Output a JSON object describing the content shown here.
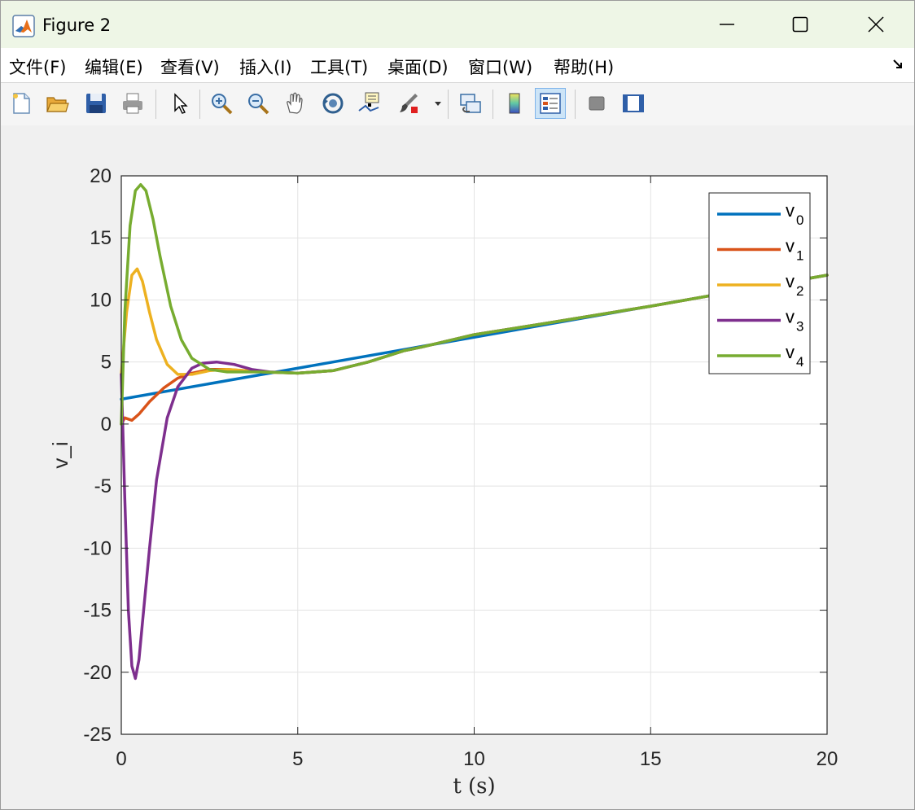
{
  "window": {
    "title": "Figure 2"
  },
  "menubar": {
    "items": [
      "文件(F)",
      "编辑(E)",
      "查看(V)",
      "插入(I)",
      "工具(T)",
      "桌面(D)",
      "窗口(W)",
      "帮助(H)"
    ]
  },
  "toolbar": {
    "icons": [
      "new-figure-icon",
      "open-file-icon",
      "save-icon",
      "print-icon",
      "pointer-icon",
      "zoom-in-icon",
      "zoom-out-icon",
      "pan-icon",
      "rotate-3d-icon",
      "data-cursor-icon",
      "brush-icon",
      "link-plot-icon",
      "colorbar-icon",
      "legend-icon",
      "hide-plot-tools-icon",
      "show-plot-tools-icon"
    ]
  },
  "chart_data": {
    "type": "line",
    "title": "",
    "xlabel": "t (s)",
    "ylabel": "v_i",
    "xlim": [
      0,
      20
    ],
    "ylim": [
      -25,
      20
    ],
    "xticks": [
      0,
      5,
      10,
      15,
      20
    ],
    "yticks": [
      -25,
      -20,
      -15,
      -10,
      -5,
      0,
      5,
      10,
      15,
      20
    ],
    "grid": true,
    "legend_position": "top-right",
    "series": [
      {
        "name": "v",
        "sub": "0",
        "color": "#0072bd",
        "x": [
          0,
          20
        ],
        "y": [
          2,
          12
        ]
      },
      {
        "name": "v",
        "sub": "1",
        "color": "#d95319",
        "x": [
          0,
          0.1,
          0.3,
          0.5,
          0.8,
          1.2,
          1.6,
          2.0,
          2.5,
          3.0,
          4.0,
          5.0,
          6.0,
          7.0,
          8.0,
          8.5,
          10,
          12,
          15,
          20
        ],
        "y": [
          0,
          0.5,
          0.3,
          0.8,
          1.8,
          2.9,
          3.7,
          4.1,
          4.4,
          4.4,
          4.2,
          4.1,
          4.3,
          5.0,
          5.9,
          6.2,
          7.2,
          8.1,
          9.5,
          12
        ]
      },
      {
        "name": "v",
        "sub": "2",
        "color": "#edb120",
        "x": [
          0,
          0.15,
          0.3,
          0.45,
          0.6,
          0.8,
          1.0,
          1.3,
          1.6,
          2.0,
          2.5,
          3.0,
          4.0,
          5.0,
          6.0,
          7.0,
          8.0,
          8.5,
          10,
          12,
          15,
          20
        ],
        "y": [
          4.0,
          9.0,
          12.0,
          12.5,
          11.5,
          9.0,
          6.8,
          4.8,
          4.0,
          4.0,
          4.3,
          4.4,
          4.2,
          4.1,
          4.3,
          5.0,
          5.9,
          6.2,
          7.2,
          8.1,
          9.5,
          12
        ]
      },
      {
        "name": "v",
        "sub": "3",
        "color": "#7e2f8e",
        "x": [
          0,
          0.1,
          0.2,
          0.3,
          0.4,
          0.5,
          0.6,
          0.8,
          1.0,
          1.3,
          1.6,
          2.0,
          2.3,
          2.7,
          3.2,
          3.7,
          4.2,
          5.0,
          6.0,
          7.0,
          8.0,
          8.5,
          10,
          12,
          15,
          20
        ],
        "y": [
          4.0,
          -6.0,
          -15.0,
          -19.5,
          -20.5,
          -19.0,
          -16.0,
          -10.0,
          -4.5,
          0.5,
          3.0,
          4.5,
          4.9,
          5.0,
          4.8,
          4.4,
          4.2,
          4.1,
          4.3,
          5.0,
          5.9,
          6.2,
          7.2,
          8.1,
          9.5,
          12
        ]
      },
      {
        "name": "v",
        "sub": "4",
        "color": "#77ac30",
        "x": [
          0,
          0.1,
          0.25,
          0.4,
          0.55,
          0.7,
          0.9,
          1.1,
          1.4,
          1.7,
          2.0,
          2.5,
          3.0,
          3.5,
          4.0,
          5.0,
          6.0,
          7.0,
          8.0,
          8.5,
          10,
          12,
          15,
          20
        ],
        "y": [
          0,
          9.0,
          16.0,
          18.8,
          19.3,
          18.8,
          16.5,
          13.5,
          9.5,
          6.8,
          5.3,
          4.4,
          4.2,
          4.2,
          4.2,
          4.1,
          4.3,
          5.0,
          5.9,
          6.2,
          7.2,
          8.1,
          9.5,
          12
        ]
      }
    ]
  }
}
